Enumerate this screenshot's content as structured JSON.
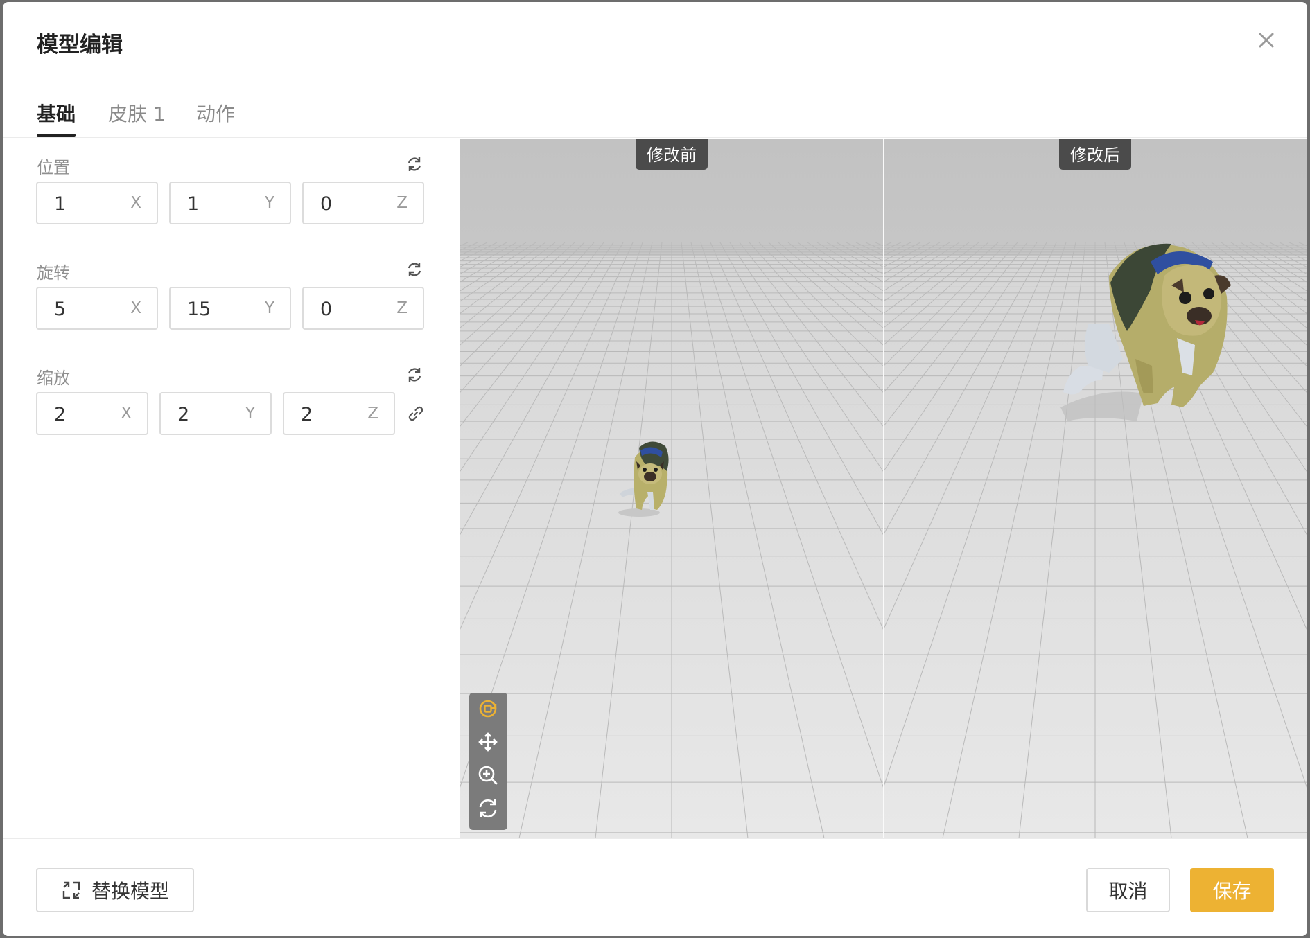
{
  "dialog": {
    "title": "模型编辑"
  },
  "tabs": [
    {
      "label": "基础",
      "active": true
    },
    {
      "label": "皮肤 1",
      "active": false
    },
    {
      "label": "动作",
      "active": false
    }
  ],
  "position": {
    "label": "位置",
    "x": "1",
    "y": "1",
    "z": "0"
  },
  "rotation": {
    "label": "旋转",
    "x": "5",
    "y": "15",
    "z": "0"
  },
  "scale": {
    "label": "缩放",
    "x": "2",
    "y": "2",
    "z": "2"
  },
  "axes": {
    "x": "X",
    "y": "Y",
    "z": "Z"
  },
  "viewports": {
    "before_label": "修改前",
    "after_label": "修改后"
  },
  "toolbar": {
    "items": [
      "orbit-focus-icon",
      "move-icon",
      "zoom-in-icon",
      "rotate-icon"
    ],
    "active_color": "#edb233"
  },
  "footer": {
    "replace_label": "替换模型",
    "cancel_label": "取消",
    "save_label": "保存"
  },
  "colors": {
    "accent": "#edb233",
    "text": "#222222",
    "muted": "#8f8f8f"
  }
}
